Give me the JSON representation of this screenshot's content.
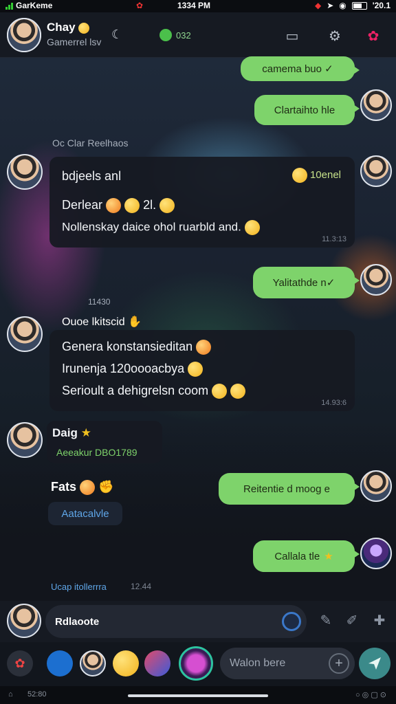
{
  "status_bar": {
    "carrier": "GarKeme",
    "time": "1334 PM",
    "battery": "'20.1"
  },
  "header": {
    "name": "Chay",
    "subtitle": "Gamerrel lsv",
    "online_count": "032",
    "icons": [
      "moon-icon",
      "online-dot-icon",
      "screen-icon",
      "settings-icon",
      "more-icon"
    ]
  },
  "messages": [
    {
      "id": "m1",
      "side": "out",
      "text": "camema buo ✓"
    },
    {
      "id": "m2",
      "side": "out",
      "text": "Clartaihto hle"
    },
    {
      "id": "m3",
      "side": "in",
      "sender": "Oc Clar Reelhaos",
      "lines": [
        "bdjeels anl",
        "Derlear",
        "Nollenskay daice ohol ruarbld and."
      ],
      "tag": "10enel",
      "extra": "2l.",
      "time": "11.3:13"
    },
    {
      "id": "m4",
      "side": "out",
      "text": "Yalitathde n✓"
    },
    {
      "id": "m5",
      "side": "in",
      "sender": "Ouoe lkitscid",
      "timestamp_label": "11430",
      "lines": [
        "Genera konstansieditan",
        "Irunenja  120oooacbya",
        "Serioult a dehigrelsn coom"
      ],
      "time": "14.93:6"
    },
    {
      "id": "m6",
      "side": "in",
      "sender": "Daig",
      "sub": "Aeeakur DBO1789"
    },
    {
      "id": "m7",
      "side": "in",
      "text": "Fats"
    },
    {
      "id": "m8",
      "side": "in",
      "link": "Aatacalvle"
    },
    {
      "id": "m9",
      "side": "out",
      "text": "Reitentie d moog e"
    },
    {
      "id": "m10",
      "side": "out",
      "text": "Callala tle"
    }
  ],
  "footer_note": {
    "text": "Ucap itollerrra",
    "time": "12.44"
  },
  "composer": {
    "text": "Rdlaoote"
  },
  "reply": {
    "placeholder": "Walon bere"
  },
  "system_bar": {
    "left": "52:80"
  },
  "colors": {
    "bubble_out": "#7ed36b",
    "bubble_in": "#161a22",
    "accent": "#3b8a8a"
  }
}
